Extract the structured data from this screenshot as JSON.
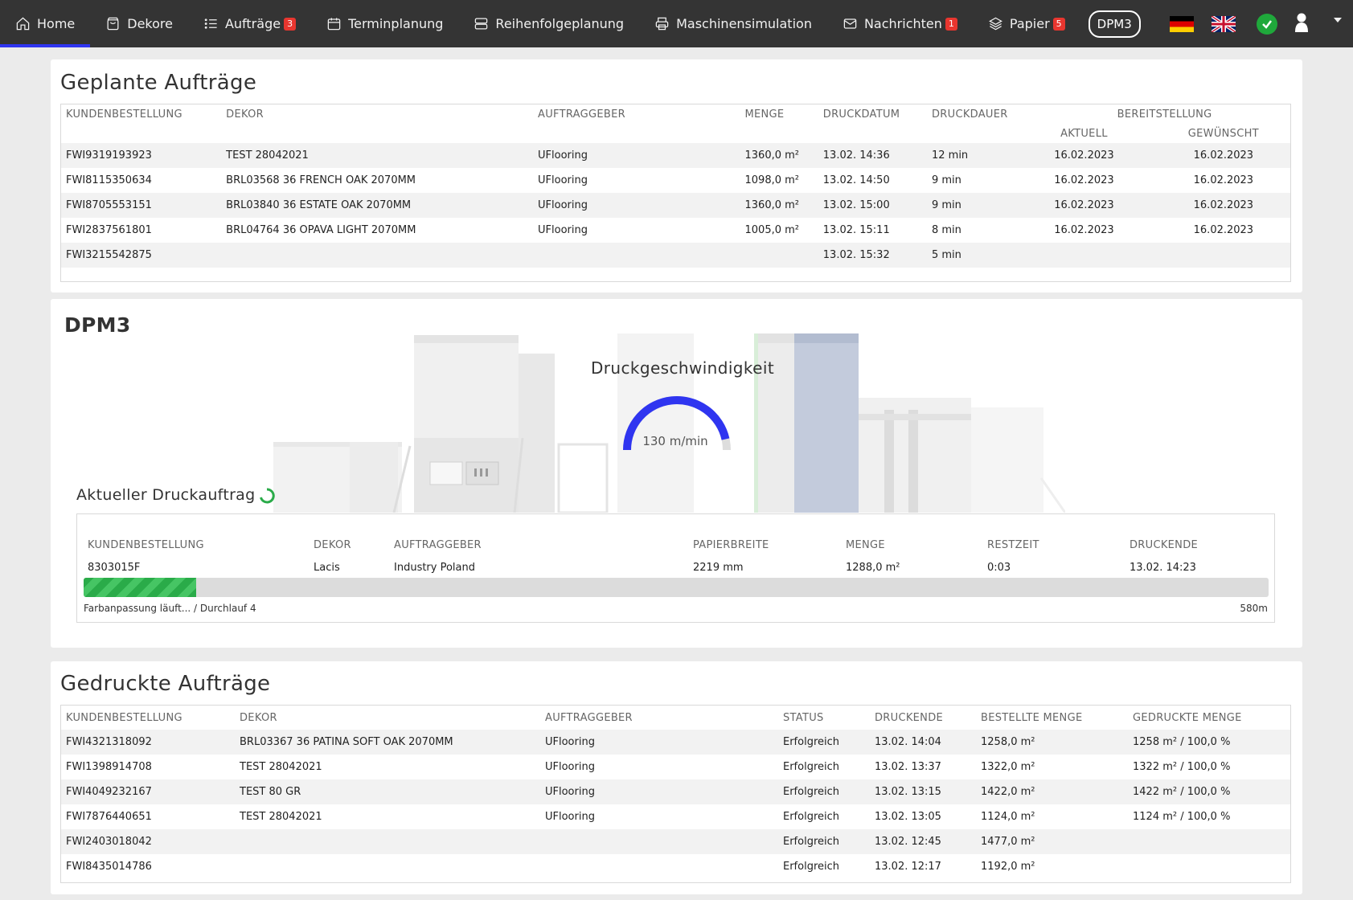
{
  "nav": {
    "items": [
      {
        "label": "Home",
        "icon": "home-icon",
        "active": true
      },
      {
        "label": "Dekore",
        "icon": "bag-icon"
      },
      {
        "label": "Aufträge",
        "icon": "list-icon",
        "badge": "3"
      },
      {
        "label": "Terminplanung",
        "icon": "calendar-icon"
      },
      {
        "label": "Reihenfolgeplanung",
        "icon": "server-icon"
      },
      {
        "label": "Maschinensimulation",
        "icon": "printer-icon"
      },
      {
        "label": "Nachrichten",
        "icon": "mail-icon",
        "badge": "1"
      },
      {
        "label": "Papier",
        "icon": "layers-icon",
        "badge": "5"
      }
    ],
    "machine_button": "DPM3",
    "colors": {
      "bar": "#343434",
      "active_underline": "#2f35f0",
      "badge": "#e8362f",
      "status_ok": "#1fa83b"
    }
  },
  "planned": {
    "title": "Geplante Aufträge",
    "headers": {
      "order": "KUNDENBESTELLUNG",
      "decor": "DEKOR",
      "client": "AUFTRAGGEBER",
      "quantity": "MENGE",
      "print_date": "DRUCKDATUM",
      "duration": "DRUCKDAUER",
      "provision": "BEREITSTELLUNG",
      "actual": "AKTUELL",
      "desired": "GEWÜNSCHT"
    },
    "rows": [
      {
        "order": "FWI9319193923",
        "decor": "TEST 28042021",
        "client": "UFlooring",
        "quantity": "1360,0 m²",
        "print_date": "13.02. 14:36",
        "duration": "12 min",
        "actual": "16.02.2023",
        "desired": "16.02.2023"
      },
      {
        "order": "FWI8115350634",
        "decor": "BRL03568 36 FRENCH OAK 2070MM",
        "client": "UFlooring",
        "quantity": "1098,0 m²",
        "print_date": "13.02. 14:50",
        "duration": "9 min",
        "actual": "16.02.2023",
        "desired": "16.02.2023"
      },
      {
        "order": "FWI8705553151",
        "decor": "BRL03840 36 ESTATE OAK 2070MM",
        "client": "UFlooring",
        "quantity": "1360,0 m²",
        "print_date": "13.02. 15:00",
        "duration": "9 min",
        "actual": "16.02.2023",
        "desired": "16.02.2023"
      },
      {
        "order": "FWI2837561801",
        "decor": "BRL04764 36 OPAVA LIGHT 2070MM",
        "client": "UFlooring",
        "quantity": "1005,0 m²",
        "print_date": "13.02. 15:11",
        "duration": "8 min",
        "actual": "16.02.2023",
        "desired": "16.02.2023"
      },
      {
        "order": "FWI3215542875",
        "decor": "",
        "client": "",
        "quantity": "",
        "print_date": "13.02. 15:32",
        "duration": "5 min",
        "actual": "",
        "desired": ""
      }
    ]
  },
  "dpm": {
    "title": "DPM3",
    "gauge": {
      "label": "Druckgeschwindigkeit",
      "value": "130 m/min",
      "fraction": 0.93,
      "color": "#2f35f0"
    },
    "current": {
      "title": "Aktueller Druckauftrag",
      "headers": {
        "order": "KUNDENBESTELLUNG",
        "decor": "DEKOR",
        "client": "AUFTRAGGEBER",
        "width": "PAPIERBREITE",
        "quantity": "MENGE",
        "remaining": "RESTZEIT",
        "print_end": "DRUCKENDE"
      },
      "row": {
        "order": "8303015F",
        "decor": "Lacis",
        "client": "Industry Poland",
        "width": "2219 mm",
        "quantity": "1288,0 m²",
        "remaining": "0:03",
        "print_end": "13.02. 14:23"
      },
      "progress": {
        "fraction": 0.095,
        "status": "Farbanpassung läuft... / Durchlauf 4",
        "meters": "580m",
        "color": "#2aab49"
      }
    }
  },
  "printed": {
    "title": "Gedruckte Aufträge",
    "headers": {
      "order": "KUNDENBESTELLUNG",
      "decor": "DEKOR",
      "client": "AUFTRAGGEBER",
      "status": "STATUS",
      "print_end": "DRUCKENDE",
      "ordered": "BESTELLTE MENGE",
      "printed": "GEDRUCKTE MENGE"
    },
    "rows": [
      {
        "order": "FWI4321318092",
        "decor": "BRL03367 36 PATINA SOFT OAK 2070MM",
        "client": "UFlooring",
        "status": "Erfolgreich",
        "print_end": "13.02. 14:04",
        "ordered": "1258,0 m²",
        "printed": "1258 m² / 100,0 %"
      },
      {
        "order": "FWI1398914708",
        "decor": "TEST 28042021",
        "client": "UFlooring",
        "status": "Erfolgreich",
        "print_end": "13.02. 13:37",
        "ordered": "1322,0 m²",
        "printed": "1322 m² / 100,0 %"
      },
      {
        "order": "FWI4049232167",
        "decor": "TEST 80 GR",
        "client": "UFlooring",
        "status": "Erfolgreich",
        "print_end": "13.02. 13:15",
        "ordered": "1422,0 m²",
        "printed": "1422 m² / 100,0 %"
      },
      {
        "order": "FWI7876440651",
        "decor": "TEST 28042021",
        "client": "UFlooring",
        "status": "Erfolgreich",
        "print_end": "13.02. 13:05",
        "ordered": "1124,0 m²",
        "printed": "1124 m² / 100,0 %"
      },
      {
        "order": "FWI2403018042",
        "decor": "",
        "client": "",
        "status": "Erfolgreich",
        "print_end": "13.02. 12:45",
        "ordered": "1477,0 m²",
        "printed": ""
      },
      {
        "order": "FWI8435014786",
        "decor": "",
        "client": "",
        "status": "Erfolgreich",
        "print_end": "13.02. 12:17",
        "ordered": "1192,0 m²",
        "printed": ""
      }
    ]
  }
}
